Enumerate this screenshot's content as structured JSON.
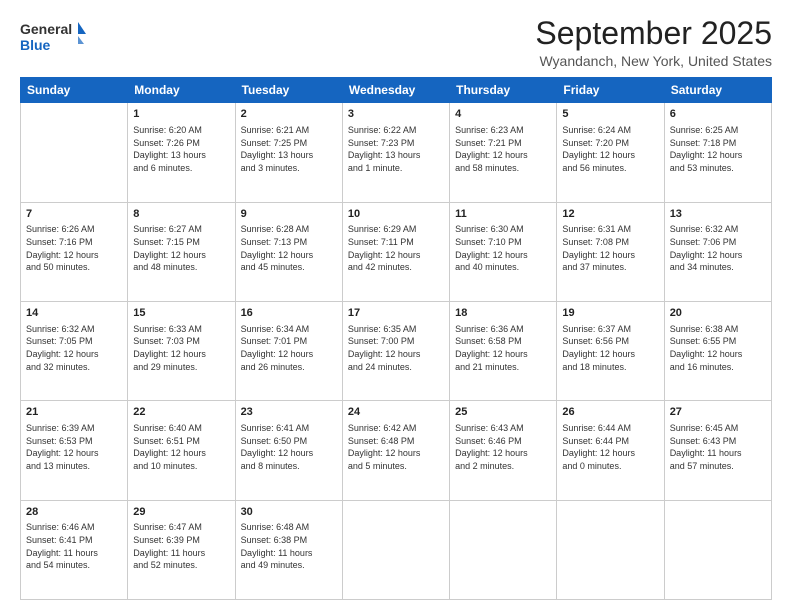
{
  "header": {
    "logo_line1": "General",
    "logo_line2": "Blue",
    "title": "September 2025",
    "location": "Wyandanch, New York, United States"
  },
  "days_of_week": [
    "Sunday",
    "Monday",
    "Tuesday",
    "Wednesday",
    "Thursday",
    "Friday",
    "Saturday"
  ],
  "weeks": [
    [
      {
        "day": "",
        "info": ""
      },
      {
        "day": "1",
        "info": "Sunrise: 6:20 AM\nSunset: 7:26 PM\nDaylight: 13 hours\nand 6 minutes."
      },
      {
        "day": "2",
        "info": "Sunrise: 6:21 AM\nSunset: 7:25 PM\nDaylight: 13 hours\nand 3 minutes."
      },
      {
        "day": "3",
        "info": "Sunrise: 6:22 AM\nSunset: 7:23 PM\nDaylight: 13 hours\nand 1 minute."
      },
      {
        "day": "4",
        "info": "Sunrise: 6:23 AM\nSunset: 7:21 PM\nDaylight: 12 hours\nand 58 minutes."
      },
      {
        "day": "5",
        "info": "Sunrise: 6:24 AM\nSunset: 7:20 PM\nDaylight: 12 hours\nand 56 minutes."
      },
      {
        "day": "6",
        "info": "Sunrise: 6:25 AM\nSunset: 7:18 PM\nDaylight: 12 hours\nand 53 minutes."
      }
    ],
    [
      {
        "day": "7",
        "info": "Sunrise: 6:26 AM\nSunset: 7:16 PM\nDaylight: 12 hours\nand 50 minutes."
      },
      {
        "day": "8",
        "info": "Sunrise: 6:27 AM\nSunset: 7:15 PM\nDaylight: 12 hours\nand 48 minutes."
      },
      {
        "day": "9",
        "info": "Sunrise: 6:28 AM\nSunset: 7:13 PM\nDaylight: 12 hours\nand 45 minutes."
      },
      {
        "day": "10",
        "info": "Sunrise: 6:29 AM\nSunset: 7:11 PM\nDaylight: 12 hours\nand 42 minutes."
      },
      {
        "day": "11",
        "info": "Sunrise: 6:30 AM\nSunset: 7:10 PM\nDaylight: 12 hours\nand 40 minutes."
      },
      {
        "day": "12",
        "info": "Sunrise: 6:31 AM\nSunset: 7:08 PM\nDaylight: 12 hours\nand 37 minutes."
      },
      {
        "day": "13",
        "info": "Sunrise: 6:32 AM\nSunset: 7:06 PM\nDaylight: 12 hours\nand 34 minutes."
      }
    ],
    [
      {
        "day": "14",
        "info": "Sunrise: 6:32 AM\nSunset: 7:05 PM\nDaylight: 12 hours\nand 32 minutes."
      },
      {
        "day": "15",
        "info": "Sunrise: 6:33 AM\nSunset: 7:03 PM\nDaylight: 12 hours\nand 29 minutes."
      },
      {
        "day": "16",
        "info": "Sunrise: 6:34 AM\nSunset: 7:01 PM\nDaylight: 12 hours\nand 26 minutes."
      },
      {
        "day": "17",
        "info": "Sunrise: 6:35 AM\nSunset: 7:00 PM\nDaylight: 12 hours\nand 24 minutes."
      },
      {
        "day": "18",
        "info": "Sunrise: 6:36 AM\nSunset: 6:58 PM\nDaylight: 12 hours\nand 21 minutes."
      },
      {
        "day": "19",
        "info": "Sunrise: 6:37 AM\nSunset: 6:56 PM\nDaylight: 12 hours\nand 18 minutes."
      },
      {
        "day": "20",
        "info": "Sunrise: 6:38 AM\nSunset: 6:55 PM\nDaylight: 12 hours\nand 16 minutes."
      }
    ],
    [
      {
        "day": "21",
        "info": "Sunrise: 6:39 AM\nSunset: 6:53 PM\nDaylight: 12 hours\nand 13 minutes."
      },
      {
        "day": "22",
        "info": "Sunrise: 6:40 AM\nSunset: 6:51 PM\nDaylight: 12 hours\nand 10 minutes."
      },
      {
        "day": "23",
        "info": "Sunrise: 6:41 AM\nSunset: 6:50 PM\nDaylight: 12 hours\nand 8 minutes."
      },
      {
        "day": "24",
        "info": "Sunrise: 6:42 AM\nSunset: 6:48 PM\nDaylight: 12 hours\nand 5 minutes."
      },
      {
        "day": "25",
        "info": "Sunrise: 6:43 AM\nSunset: 6:46 PM\nDaylight: 12 hours\nand 2 minutes."
      },
      {
        "day": "26",
        "info": "Sunrise: 6:44 AM\nSunset: 6:44 PM\nDaylight: 12 hours\nand 0 minutes."
      },
      {
        "day": "27",
        "info": "Sunrise: 6:45 AM\nSunset: 6:43 PM\nDaylight: 11 hours\nand 57 minutes."
      }
    ],
    [
      {
        "day": "28",
        "info": "Sunrise: 6:46 AM\nSunset: 6:41 PM\nDaylight: 11 hours\nand 54 minutes."
      },
      {
        "day": "29",
        "info": "Sunrise: 6:47 AM\nSunset: 6:39 PM\nDaylight: 11 hours\nand 52 minutes."
      },
      {
        "day": "30",
        "info": "Sunrise: 6:48 AM\nSunset: 6:38 PM\nDaylight: 11 hours\nand 49 minutes."
      },
      {
        "day": "",
        "info": ""
      },
      {
        "day": "",
        "info": ""
      },
      {
        "day": "",
        "info": ""
      },
      {
        "day": "",
        "info": ""
      }
    ]
  ]
}
